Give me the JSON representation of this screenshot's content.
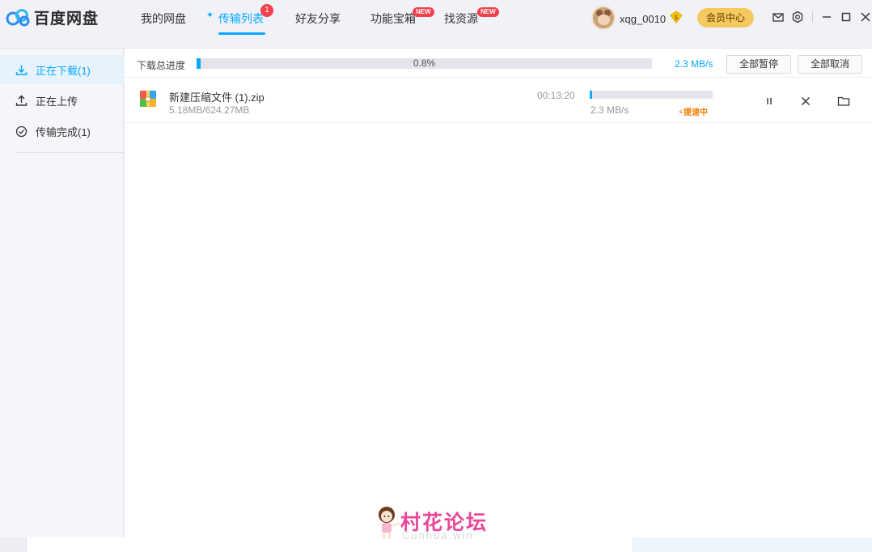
{
  "app": {
    "name": "百度网盘"
  },
  "nav": {
    "items": [
      {
        "label": "我的网盘"
      },
      {
        "label": "传输列表",
        "badge": "1",
        "active": true
      },
      {
        "label": "好友分享"
      },
      {
        "label": "功能宝箱",
        "badge": "NEW"
      },
      {
        "label": "找资源",
        "badge": "NEW"
      }
    ]
  },
  "user": {
    "name": "xqg_0010",
    "vip_button": "会员中心"
  },
  "sidebar": {
    "items": [
      {
        "label": "正在下载(1)",
        "icon": "download-icon",
        "active": true
      },
      {
        "label": "正在上传",
        "icon": "upload-icon"
      },
      {
        "label": "传输完成(1)",
        "icon": "check-circle-icon"
      }
    ]
  },
  "summary": {
    "label": "下载总进度",
    "percent_text": "0.8%",
    "progress": 0.008,
    "speed": "2.3 MB/s",
    "pause_all": "全部暂停",
    "cancel_all": "全部取消"
  },
  "downloads": [
    {
      "name": "新建压缩文件 (1).zip",
      "size": "5.18MB/624.27MB",
      "time_left": "00:13:20",
      "progress": 0.008,
      "speed": "2.3 MB/s",
      "status": "提速中"
    }
  ],
  "watermark": {
    "title": "村花论坛",
    "subtitle": "Cunhua.win"
  },
  "colors": {
    "accent": "#06a7ff",
    "badge": "#f0414c",
    "vip": "#f6c960",
    "speedup": "#f27c00"
  }
}
